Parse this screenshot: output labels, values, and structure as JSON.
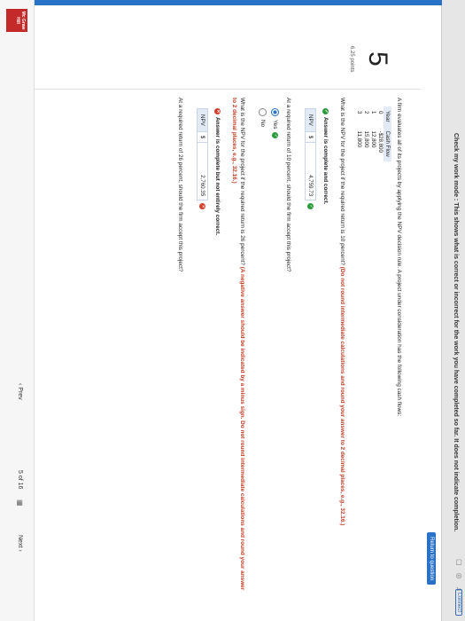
{
  "header": {
    "message": "Check my work mode : This shows what is correct or incorrect for the work you have completed so far. It does not indicate completion.",
    "connect_label": "Connect"
  },
  "sidebar": {
    "return_label": "Return to question"
  },
  "question": {
    "number": "5",
    "points": "6.25 points",
    "intro": "A firm evaluates all of its projects by applying the NPV decision rule. A project under consideration has the following cash flows:",
    "table": {
      "headers": [
        "Year",
        "Cash Flow"
      ],
      "rows": [
        [
          "0",
          "-$28,800"
        ],
        [
          "1",
          "12,800"
        ],
        [
          "2",
          "15,800"
        ],
        [
          "3",
          "11,800"
        ]
      ]
    },
    "part1": {
      "prompt": "What is the NPV for the project if the required return is 10 percent?",
      "instruction": "(Do not round intermediate calculations and round your answer to 2 decimal places, e.g., 32.16.)",
      "status": "Answer is complete and correct.",
      "label": "NPV",
      "currency": "$",
      "value": "4,759.73"
    },
    "part2": {
      "prompt": "At a required return of 10 percent, should the firm accept this project?",
      "options": [
        "Yes",
        "No"
      ]
    },
    "part3": {
      "prompt": "What is the NPV for the project if the required return is 26 percent?",
      "instruction": "(A negative answer should be indicated by a minus sign. Do not round intermediate calculations and round your answer to 2 decimal places, e.g., 32.16.)",
      "status": "Answer is complete but not entirely correct.",
      "label": "NPV",
      "currency": "$",
      "value": "2,760.35"
    },
    "part4": {
      "prompt": "At a required return of 26 percent, should the firm accept this project?"
    }
  },
  "footer": {
    "prev_label": "Prev",
    "page_current": "5",
    "page_of": "of",
    "page_total": "16",
    "next_label": "Next",
    "logo_text": "Mc Graw Hill"
  }
}
